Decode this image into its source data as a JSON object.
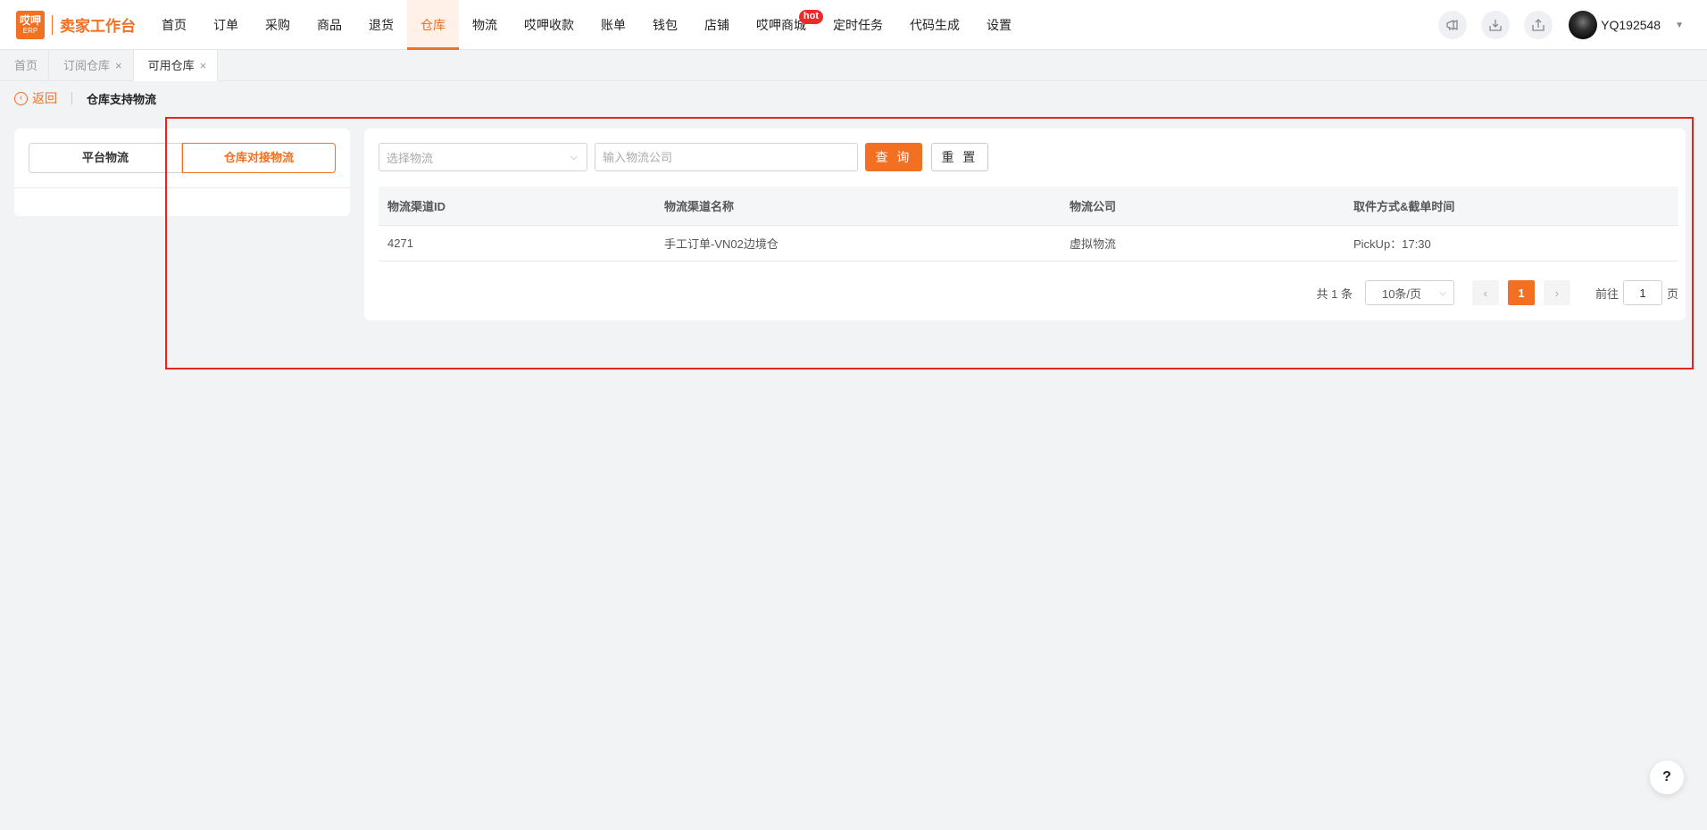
{
  "brand": {
    "badge_top": "哎呷",
    "badge_bottom": "ERP",
    "name": "卖家工作台"
  },
  "nav": {
    "items": [
      "首页",
      "订单",
      "采购",
      "商品",
      "退货",
      "仓库",
      "物流",
      "哎呷收款",
      "账单",
      "钱包",
      "店铺",
      "哎呷商城",
      "定时任务",
      "代码生成",
      "设置"
    ],
    "active": "仓库",
    "hot_badge": "hot"
  },
  "user": {
    "name": "YQ192548"
  },
  "tabs": [
    {
      "label": "首页",
      "closable": false
    },
    {
      "label": "订阅仓库",
      "closable": true,
      "close": "×"
    },
    {
      "label": "可用仓库",
      "closable": true,
      "close": "×",
      "active": true
    }
  ],
  "breadcrumb": {
    "back_label": "返回",
    "title": "仓库支持物流"
  },
  "left_panel": {
    "segments": [
      "平台物流",
      "仓库对接物流"
    ],
    "selected": "仓库对接物流"
  },
  "filters": {
    "logistics_select_placeholder": "选择物流",
    "company_input_placeholder": "输入物流公司",
    "query_label": "查 询",
    "reset_label": "重 置"
  },
  "table": {
    "headers": [
      "物流渠道ID",
      "物流渠道名称",
      "物流公司",
      "取件方式&截单时间"
    ],
    "rows": [
      [
        "4271",
        "手工订单-VN02边境仓",
        "虚拟物流",
        "PickUp：17:30"
      ]
    ]
  },
  "pagination": {
    "total_text": "共 1 条",
    "page_size": "10条/页",
    "current_page": "1",
    "goto_label": "前往",
    "goto_value": "1",
    "page_suffix": "页"
  },
  "help_label": "?",
  "colors": {
    "accent": "#f36f21",
    "highlight_border": "#e8231b",
    "hot": "#ee2a2a"
  },
  "icons": {
    "announce": "megaphone-icon",
    "download": "download-icon",
    "share": "upload-icon"
  }
}
